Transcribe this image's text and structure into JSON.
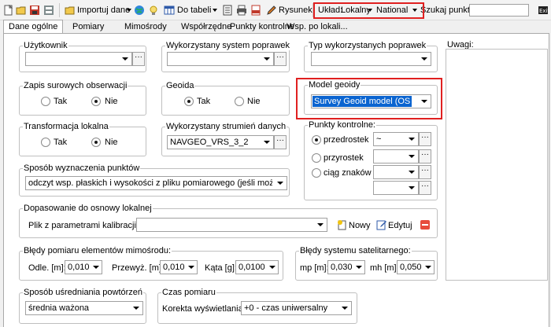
{
  "toolbar": {
    "import_label": "Importuj dane",
    "to_table_label": "Do tabeli",
    "drawing_label": "Rysunek",
    "system_label": "Układ:",
    "system_value": "Lokalny",
    "geoid_value": "National G",
    "search_label": "Szukaj punktu:",
    "search_value": ""
  },
  "tabs": [
    "Dane ogólne",
    "Pomiary",
    "Mimośrody",
    "Współrzędne",
    "Punkty kontrolne",
    "Wsp. po lokali..."
  ],
  "groups": {
    "user": {
      "title": "Użytkownik",
      "value": ""
    },
    "correction_system": {
      "title": "Wykorzystany system poprawek",
      "value": ""
    },
    "correction_type": {
      "title": "Typ wykorzystanych poprawek",
      "value": ""
    },
    "raw_obs": {
      "title": "Zapis surowych obserwacji",
      "yes": "Tak",
      "no": "Nie"
    },
    "geoid": {
      "title": "Geoida",
      "yes": "Tak",
      "no": "Nie"
    },
    "geoid_model": {
      "title": "Model geoidy",
      "value": "Survey Geoid model (OS"
    },
    "local_transform": {
      "title": "Transformacja lokalna",
      "yes": "Tak",
      "no": "Nie"
    },
    "data_stream": {
      "title": "Wykorzystany strumień danych",
      "value": "NAVGEO_VRS_3_2"
    },
    "control_points": {
      "title": "Punkty kontrolne:",
      "prefix_label": "przedrostek",
      "prefix_value": "~",
      "suffix_label": "przyrostek",
      "chars_label": "ciąg znaków"
    },
    "point_method": {
      "title": "Sposób wyznaczenia punktów",
      "value": "odczyt wsp. płaskich i wysokości z pliku pomiarowego (jeśli możliwe)"
    },
    "fit": {
      "title": "Dopasowanie do osnowy lokalnej",
      "file_label": "Plik z parametrami kalibracji:",
      "file_value": "",
      "new_label": "Nowy",
      "edit_label": "Edytuj"
    },
    "eccentric_errors": {
      "title": "Błędy pomiaru elementów mimośrodu:",
      "offset_label": "Odle. [m]:",
      "offset_value": "0,010",
      "shift_label": "Przewyż. [m]:",
      "shift_value": "0,010",
      "angle_label": "Kąta [g]:",
      "angle_value": "0,0100"
    },
    "satellite_errors": {
      "title": "Błędy systemu satelitarnego:",
      "mp_label": "mp [m]:",
      "mp_value": "0,030",
      "mh_label": "mh [m]:",
      "mh_value": "0,050"
    },
    "averaging": {
      "title": "Sposób uśredniania powtórzeń",
      "value": "średnia ważona"
    },
    "time": {
      "title": "Czas pomiaru",
      "label": "Korekta wyświetlania:",
      "value": "+0 - czas uniwersalny"
    },
    "notes": {
      "title": "Uwagi:"
    }
  },
  "colors": {
    "highlight": "#e02020",
    "selection": "#0a64d0"
  }
}
